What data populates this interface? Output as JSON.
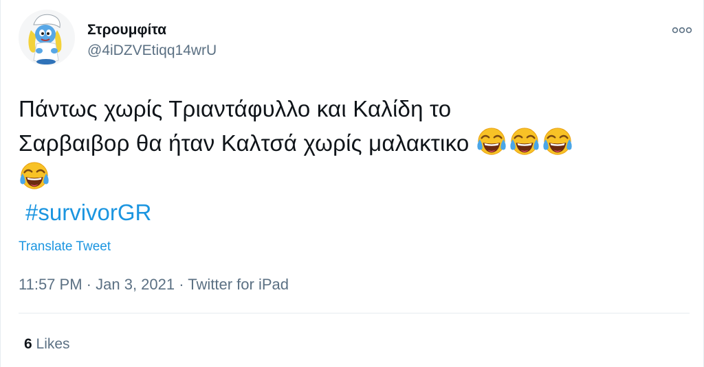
{
  "tweet": {
    "display_name": "Στρουμφίτα",
    "handle": "@4iDZVEtiqq14wrU",
    "text_line1": "Πάντως χωρίς Τριαντάφυλλο και Καλίδη το",
    "text_line2": "Σαρβαιβορ θα ήταν Καλτσά χωρίς μαλακτικο",
    "hashtag": "#survivorGR",
    "translate_label": "Translate Tweet",
    "time": "11:57 PM",
    "date": "Jan 3, 2021",
    "source": "Twitter for iPad",
    "separator": "·",
    "likes_count": "6",
    "likes_label": "Likes",
    "emoji": "face-with-tears-of-joy-icon",
    "colors": {
      "link": "#1b95e0",
      "secondary": "#5b7083",
      "primary": "#0f1419",
      "divider": "#e6ecf0"
    }
  }
}
